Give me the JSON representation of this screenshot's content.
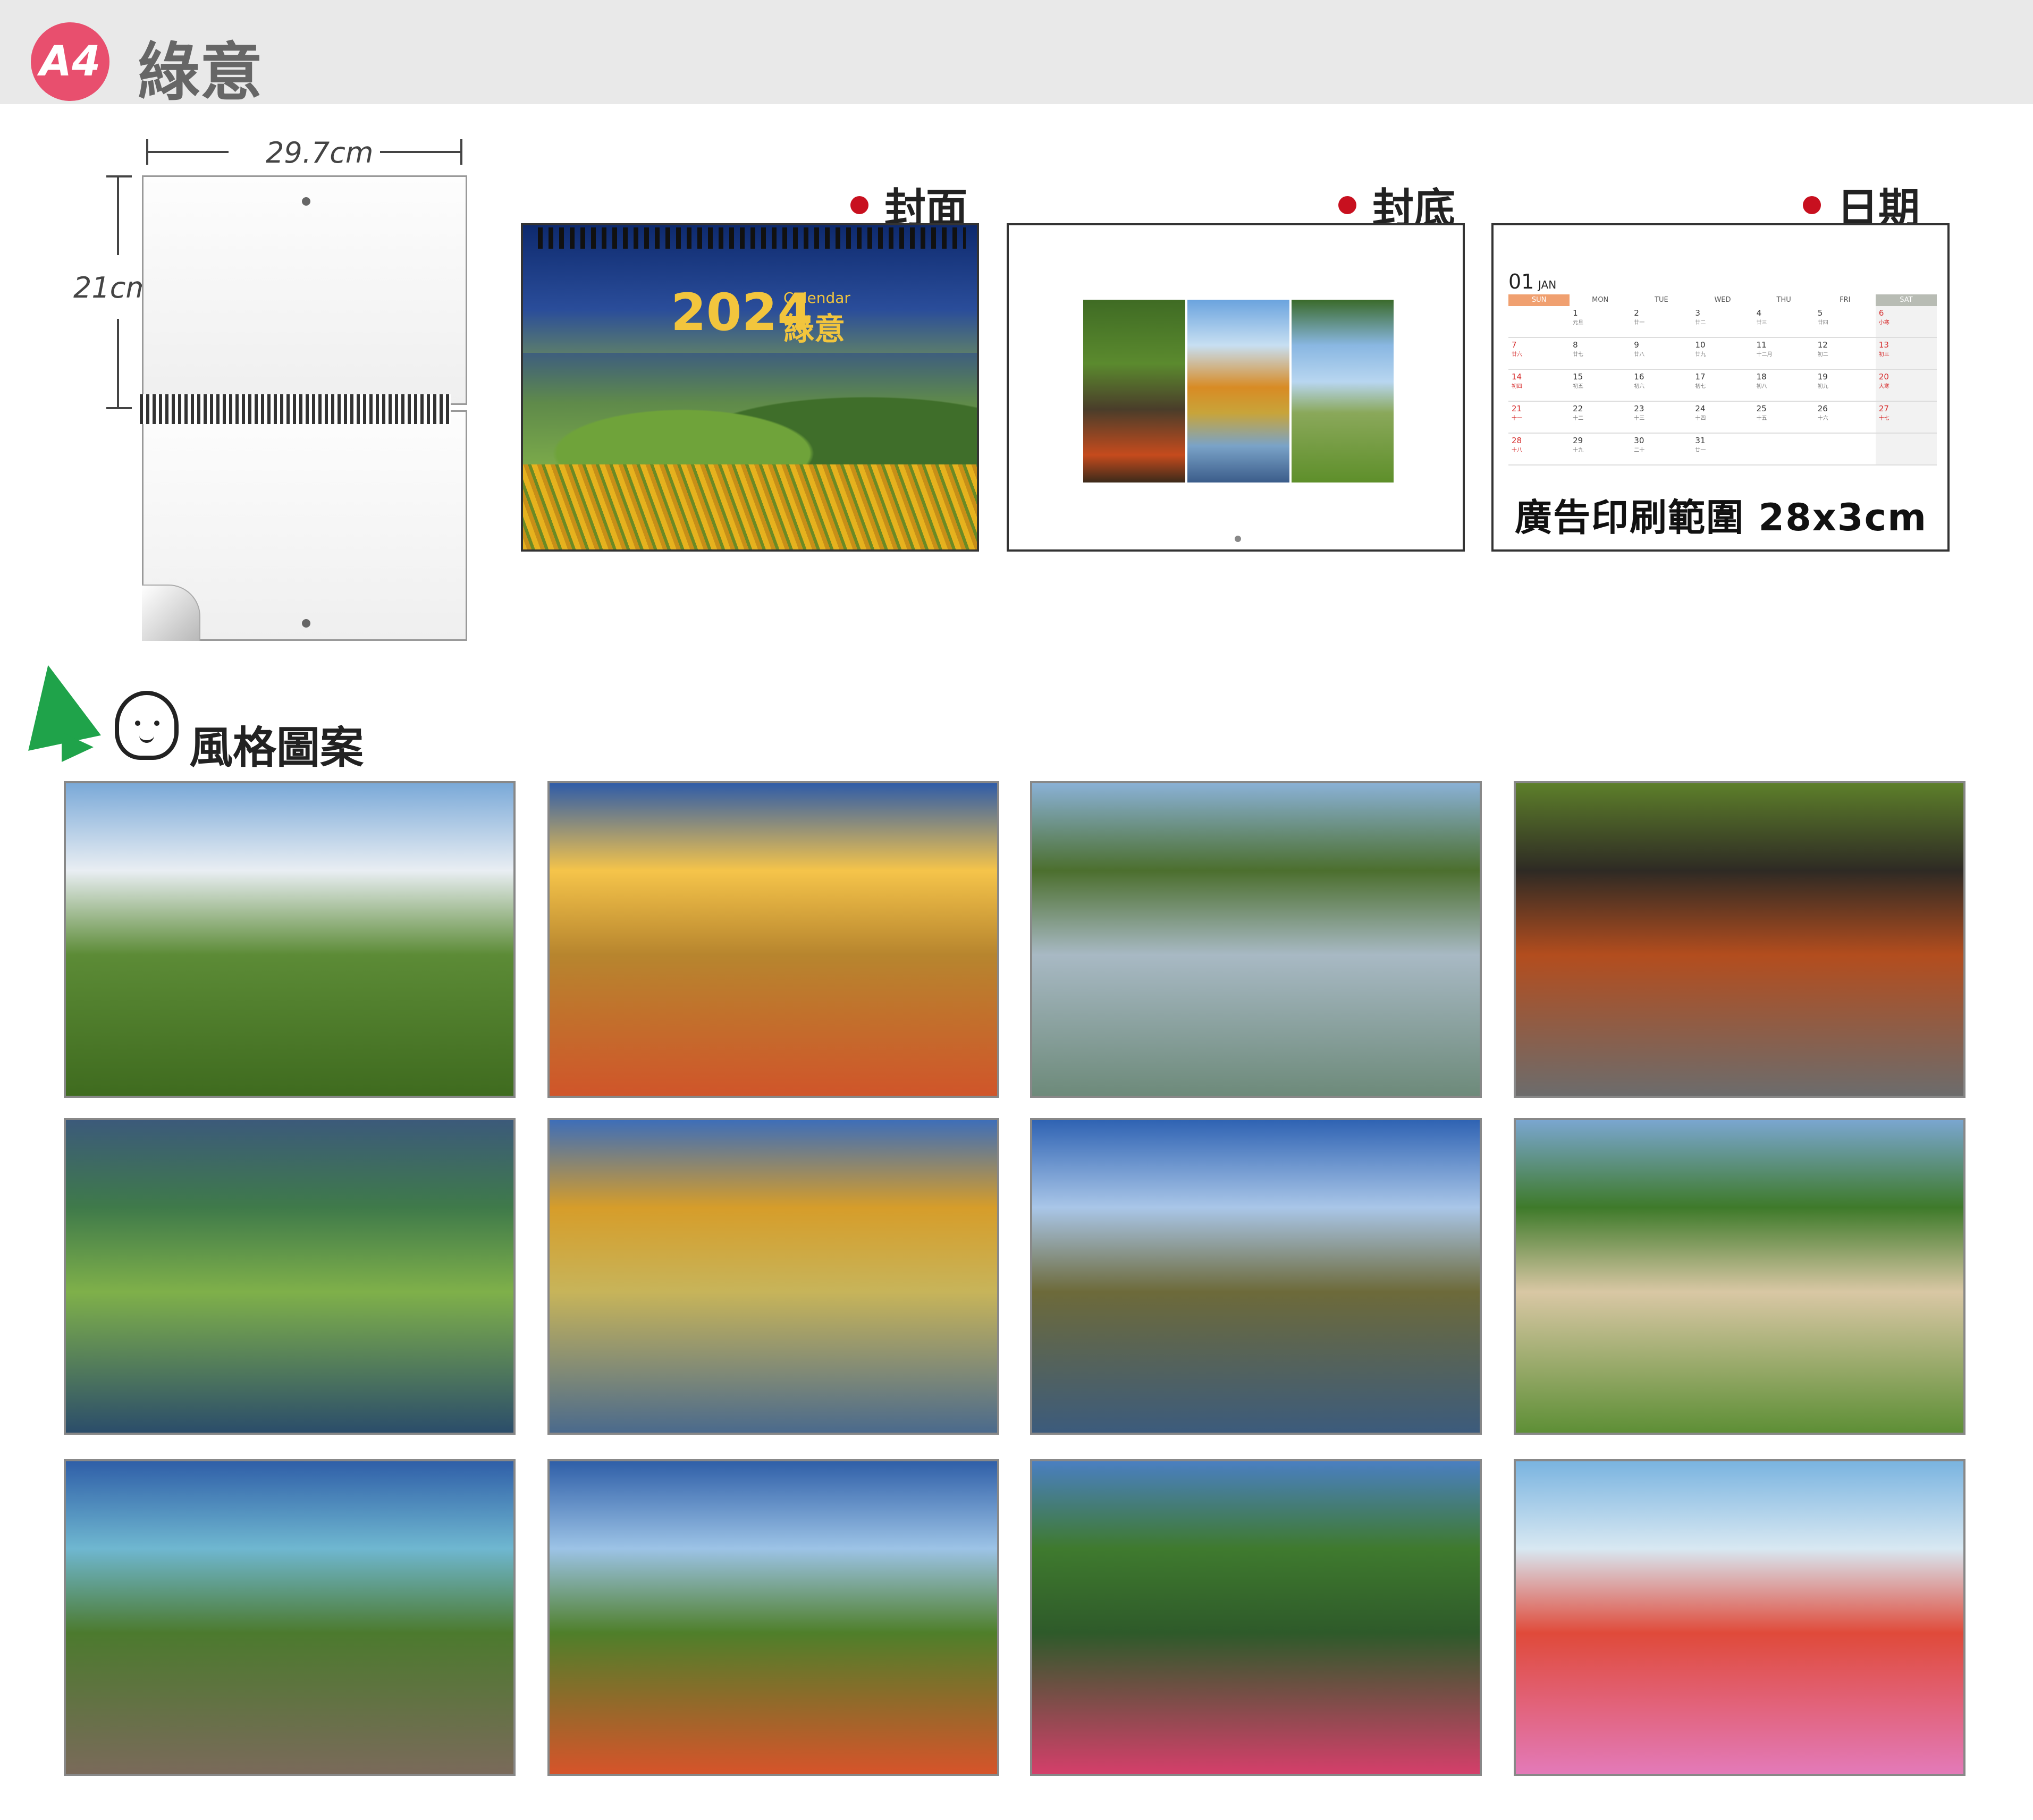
{
  "header": {
    "badge": "A4",
    "title": "綠意"
  },
  "dimensions": {
    "width": "29.7cm",
    "height": "21cm"
  },
  "sections": {
    "cover": "封面",
    "back": "封底",
    "date": "日期"
  },
  "cover": {
    "year": "2024",
    "calendar_word": "Calendar",
    "name": "綠意"
  },
  "date_page": {
    "month_number": "01",
    "month_name": "JAN",
    "weekdays": [
      "SUN",
      "MON",
      "TUE",
      "WED",
      "THU",
      "FRI",
      "SAT"
    ],
    "days": [
      [
        "",
        "",
        "",
        "",
        "",
        "",
        ""
      ],
      [
        "1",
        "元旦"
      ],
      [
        "2",
        "廿一"
      ],
      [
        "3",
        "廿二"
      ],
      [
        "4",
        "廿三"
      ],
      [
        "5",
        "廿四"
      ],
      [
        "6",
        "小寒"
      ],
      [
        "7",
        "廿六"
      ],
      [
        "8",
        "廿七"
      ],
      [
        "9",
        "廿八"
      ],
      [
        "10",
        "廿九"
      ],
      [
        "11",
        "十二月"
      ],
      [
        "12",
        "初二"
      ],
      [
        "13",
        "初三"
      ],
      [
        "14",
        "初四"
      ],
      [
        "15",
        "初五"
      ],
      [
        "16",
        "初六"
      ],
      [
        "17",
        "初七"
      ],
      [
        "18",
        "初八"
      ],
      [
        "19",
        "初九"
      ],
      [
        "20",
        "大寒"
      ],
      [
        "21",
        "十一"
      ],
      [
        "22",
        "十二"
      ],
      [
        "23",
        "十三"
      ],
      [
        "24",
        "十四"
      ],
      [
        "25",
        "十五"
      ],
      [
        "26",
        "十六"
      ],
      [
        "27",
        "十七"
      ],
      [
        "28",
        "十八"
      ],
      [
        "29",
        "十九"
      ],
      [
        "30",
        "二十"
      ],
      [
        "31",
        "廿一"
      ]
    ],
    "ad_range": "廣告印刷範圍 28x3cm"
  },
  "style_section": {
    "title": "風格圖案"
  },
  "thumbnails": [
    {
      "name": "daylily-field-farmers",
      "colors": [
        "#7aa9d8",
        "#e9eef3",
        "#5c8b36",
        "#3f6b1f"
      ]
    },
    {
      "name": "coastal-sunset-flowers",
      "colors": [
        "#2f5ca8",
        "#f5c44a",
        "#b7852e",
        "#d0552a"
      ]
    },
    {
      "name": "tree-rice-paddy-farmer",
      "colors": [
        "#8ab1d6",
        "#4c6f2e",
        "#a8b9c4",
        "#6d8a7a"
      ]
    },
    {
      "name": "forest-stream-rocks",
      "colors": [
        "#5d7f2a",
        "#2e2a24",
        "#b34d1e",
        "#6c6c6c"
      ]
    },
    {
      "name": "seaweed-harvest",
      "colors": [
        "#3c5a7a",
        "#3f7a4a",
        "#7fb04a",
        "#2b4d6a"
      ]
    },
    {
      "name": "autumn-trees-reflection",
      "colors": [
        "#3e6eb8",
        "#d69d2a",
        "#c7b45a",
        "#4b6a8c"
      ]
    },
    {
      "name": "basalt-island-reflection",
      "colors": [
        "#2f63b3",
        "#a9c6e8",
        "#6d6a3a",
        "#3c5b7c"
      ]
    },
    {
      "name": "grazing-sheep",
      "colors": [
        "#7aa6d0",
        "#3e7a2a",
        "#d9c7a4",
        "#5e8f36"
      ]
    },
    {
      "name": "coastal-railway",
      "colors": [
        "#2f5fa8",
        "#6fb7d0",
        "#4c7a2e",
        "#7a6a5a"
      ]
    },
    {
      "name": "mesa-flower-field",
      "colors": [
        "#2f5fa8",
        "#9cc3e6",
        "#4f7f2a",
        "#d6542a"
      ]
    },
    {
      "name": "mountain-pink-flowers",
      "colors": [
        "#4a7fc1",
        "#3f7a2e",
        "#2e5a2a",
        "#d43f6a"
      ]
    },
    {
      "name": "hot-air-balloons",
      "colors": [
        "#7ab4e0",
        "#d8e8f2",
        "#e04a3a",
        "#e37ab8"
      ]
    }
  ],
  "colors": {
    "badge": "#e84f6e",
    "dot": "#c8101f",
    "accent_green": "#1fa34a",
    "header_bg": "#e9e9e9"
  }
}
